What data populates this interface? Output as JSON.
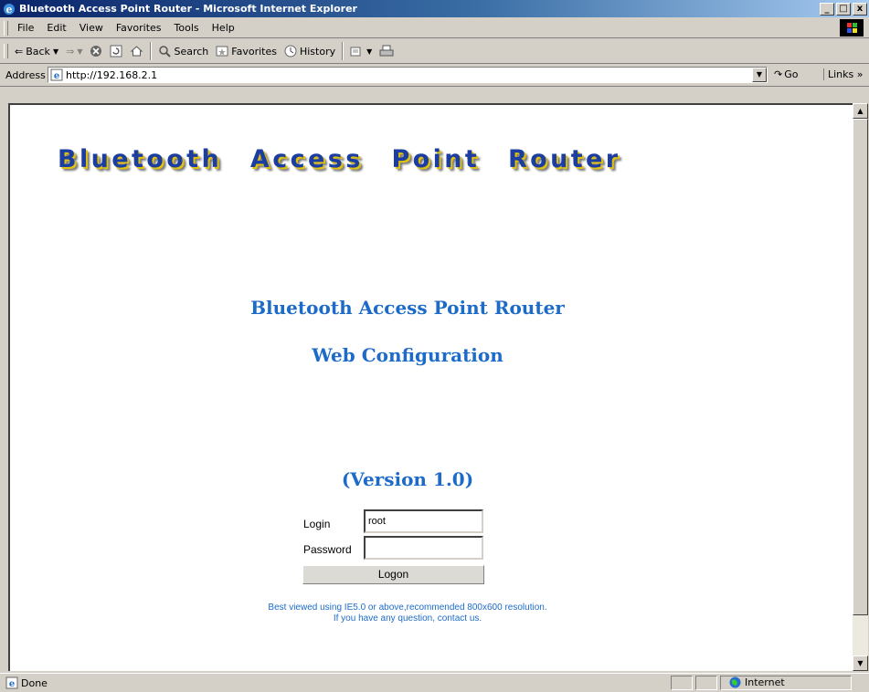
{
  "window": {
    "title": "Bluetooth Access Point Router - Microsoft Internet Explorer",
    "minimize": "_",
    "maximize": "□",
    "close": "x"
  },
  "menu": {
    "items": [
      "File",
      "Edit",
      "View",
      "Favorites",
      "Tools",
      "Help"
    ]
  },
  "toolbar": {
    "back": "Back",
    "search": "Search",
    "favorites": "Favorites",
    "history": "History"
  },
  "address": {
    "label": "Address",
    "url": "http://192.168.2.1",
    "go": "Go",
    "links": "Links »"
  },
  "page": {
    "banner": "Bluetooth Access Point Router",
    "title_line1": "Bluetooth Access Point Router",
    "title_line2": "Web Configuration",
    "version": "(Version 1.0)",
    "login_label": "Login",
    "login_value": "root",
    "password_label": "Password",
    "password_value": "",
    "logon_button": "Logon",
    "note_line1": "Best viewed using IE5.0 or above,recommended 800x600 resolution.",
    "note_line2": "If you have any question, contact us."
  },
  "status": {
    "text": "Done",
    "zone": "Internet"
  },
  "colors": {
    "heading": "#1d6bc9",
    "banner": "#1c3ea0",
    "titlebar": "#0a246a"
  }
}
